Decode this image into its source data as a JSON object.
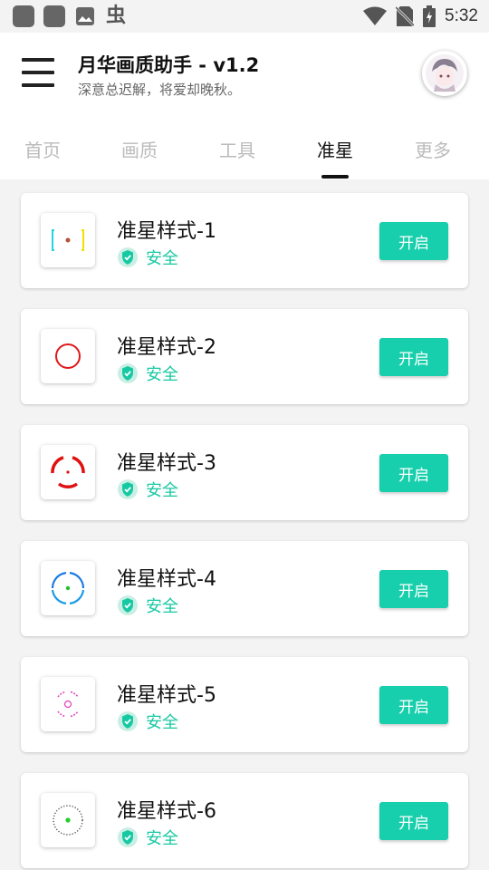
{
  "status_bar": {
    "time": "5:32",
    "left_icons": [
      "app-square-icon",
      "app-square-icon",
      "image-icon",
      "bug-icon"
    ],
    "right_icons": [
      "wifi-icon",
      "no-sim-icon",
      "battery-charging-icon"
    ],
    "bug_glyph": "虫"
  },
  "header": {
    "title": "月华画质助手 - v1.2",
    "subtitle": "深意总迟解，将爱却晚秋。"
  },
  "tabs": [
    "首页",
    "画质",
    "工具",
    "准星",
    "更多"
  ],
  "active_tab": "准星",
  "colors": {
    "accent": "#17cfac",
    "safe_green": "#17c9a3",
    "active_tab": "#111111",
    "inactive_tab": "#bbbbbb"
  },
  "items": [
    {
      "title": "准星样式-1",
      "badge": "安全",
      "button": "开启",
      "icon": "crosshair-brackets-icon"
    },
    {
      "title": "准星样式-2",
      "badge": "安全",
      "button": "开启",
      "icon": "crosshair-red-circle-icon"
    },
    {
      "title": "准星样式-3",
      "badge": "安全",
      "button": "开启",
      "icon": "crosshair-red-arcs-icon"
    },
    {
      "title": "准星样式-4",
      "badge": "安全",
      "button": "开启",
      "icon": "crosshair-blue-arcs-icon"
    },
    {
      "title": "准星样式-5",
      "badge": "安全",
      "button": "开启",
      "icon": "crosshair-pink-dotted-icon"
    },
    {
      "title": "准星样式-6",
      "badge": "安全",
      "button": "开启",
      "icon": "crosshair-gray-dotted-icon"
    }
  ]
}
